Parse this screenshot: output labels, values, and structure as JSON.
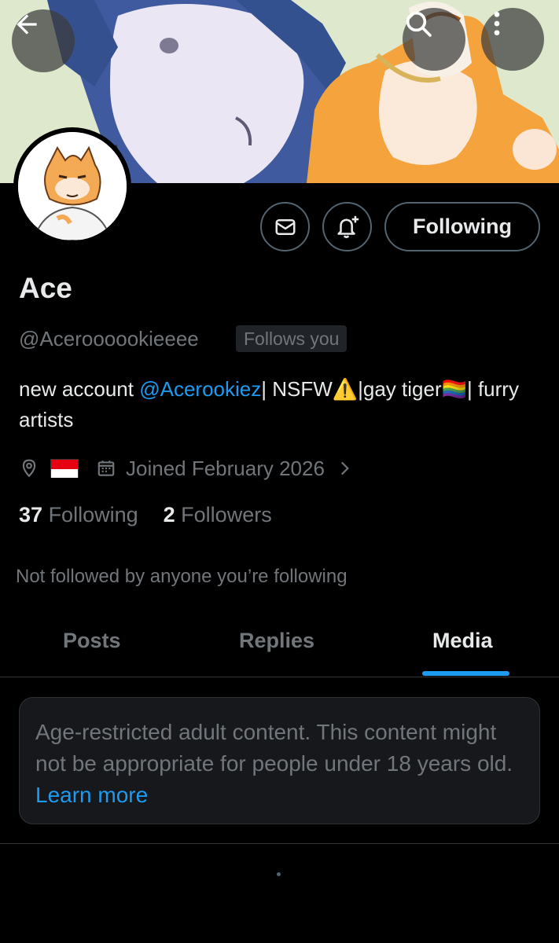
{
  "header": {
    "back_icon": "arrow-left-icon",
    "search_icon": "search-icon",
    "more_icon": "more-vertical-icon"
  },
  "profile": {
    "name": "Ace",
    "handle": "@Aceroooookieeee",
    "follows_you": "Follows you",
    "bio": {
      "prefix": "new account ",
      "mention": "@Acerookiez",
      "suffix": "| NSFW⚠️|gay tiger🏳️‍🌈| furry artists"
    },
    "location_flag": "🇮🇩",
    "joined": "Joined February 2026",
    "following_count": "37",
    "following_label": "Following",
    "followers_count": "2",
    "followers_label": "Followers",
    "not_followed": "Not followed by anyone you’re following"
  },
  "actions": {
    "message_icon": "envelope-icon",
    "notify_icon": "bell-plus-icon",
    "follow_label": "Following"
  },
  "tabs": [
    {
      "label": "Posts",
      "active": false
    },
    {
      "label": "Replies",
      "active": false
    },
    {
      "label": "Media",
      "active": true
    }
  ],
  "notice": {
    "text": "Age-restricted adult content. This content might not be appropriate for people under 18 years old. ",
    "link": "Learn more"
  },
  "colors": {
    "accent": "#1d9bf0",
    "muted": "#71767b",
    "background": "#000000"
  }
}
